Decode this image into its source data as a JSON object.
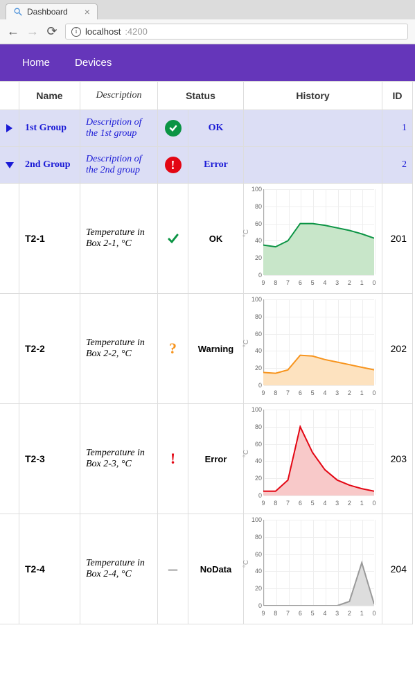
{
  "browser": {
    "tab_title": "Dashboard",
    "url_host": "localhost",
    "url_port": ":4200"
  },
  "nav": {
    "home": "Home",
    "devices": "Devices"
  },
  "headers": {
    "name": "Name",
    "description": "Description",
    "status": "Status",
    "history": "History",
    "id": "ID"
  },
  "groups": [
    {
      "expanded": false,
      "name": "1st Group",
      "description": "Description of the 1st group",
      "status_icon": "ok-circle",
      "status_label": "OK",
      "id": "1"
    },
    {
      "expanded": true,
      "name": "2nd Group",
      "description": "Description of the 2nd group",
      "status_icon": "error-circle",
      "status_label": "Error",
      "id": "2"
    }
  ],
  "rows": [
    {
      "name": "T2-1",
      "description": "Temperature in Box 2-1, °C",
      "status_icon": "ok-check",
      "status_label": "OK",
      "id": "201",
      "chart_color": "green"
    },
    {
      "name": "T2-2",
      "description": "Temperature in Box 2-2, °C",
      "status_icon": "warning-q",
      "status_label": "Warning",
      "id": "202",
      "chart_color": "orange"
    },
    {
      "name": "T2-3",
      "description": "Temperature in Box 2-3, °C",
      "status_icon": "error-bang",
      "status_label": "Error",
      "id": "203",
      "chart_color": "red"
    },
    {
      "name": "T2-4",
      "description": "Temperature in Box 2-4, °C",
      "status_icon": "nodata-dash",
      "status_label": "NoData",
      "id": "204",
      "chart_color": "grey"
    }
  ],
  "chart_data": [
    {
      "type": "area",
      "title": "",
      "xlabel": "",
      "ylabel": "°C",
      "x": [
        9,
        8,
        7,
        6,
        5,
        4,
        3,
        2,
        1,
        0
      ],
      "values": [
        35,
        33,
        40,
        60,
        60,
        58,
        55,
        52,
        48,
        43
      ],
      "ylim": [
        0,
        100
      ],
      "stroke": "#0b9444",
      "fill": "#c8e6c9"
    },
    {
      "type": "area",
      "title": "",
      "xlabel": "",
      "ylabel": "°C",
      "x": [
        9,
        8,
        7,
        6,
        5,
        4,
        3,
        2,
        1,
        0
      ],
      "values": [
        15,
        14,
        18,
        35,
        34,
        30,
        27,
        24,
        21,
        18
      ],
      "ylim": [
        0,
        100
      ],
      "stroke": "#f7941d",
      "fill": "#fde2bf"
    },
    {
      "type": "area",
      "title": "",
      "xlabel": "",
      "ylabel": "°C",
      "x": [
        9,
        8,
        7,
        6,
        5,
        4,
        3,
        2,
        1,
        0
      ],
      "values": [
        5,
        5,
        18,
        80,
        50,
        30,
        18,
        12,
        8,
        5
      ],
      "ylim": [
        0,
        100
      ],
      "stroke": "#e30613",
      "fill": "#f8c9c9"
    },
    {
      "type": "area",
      "title": "",
      "xlabel": "",
      "ylabel": "°C",
      "x": [
        9,
        8,
        7,
        6,
        5,
        4,
        3,
        2,
        1,
        0
      ],
      "values": [
        0,
        0,
        0,
        0,
        0,
        0,
        0,
        5,
        50,
        2
      ],
      "ylim": [
        0,
        100
      ],
      "stroke": "#999999",
      "fill": "#dddddd"
    }
  ],
  "chart_axis": {
    "y_ticks": [
      0,
      20,
      40,
      60,
      80,
      100
    ],
    "x_ticks": [
      9,
      8,
      7,
      6,
      5,
      4,
      3,
      2,
      1,
      0
    ]
  }
}
